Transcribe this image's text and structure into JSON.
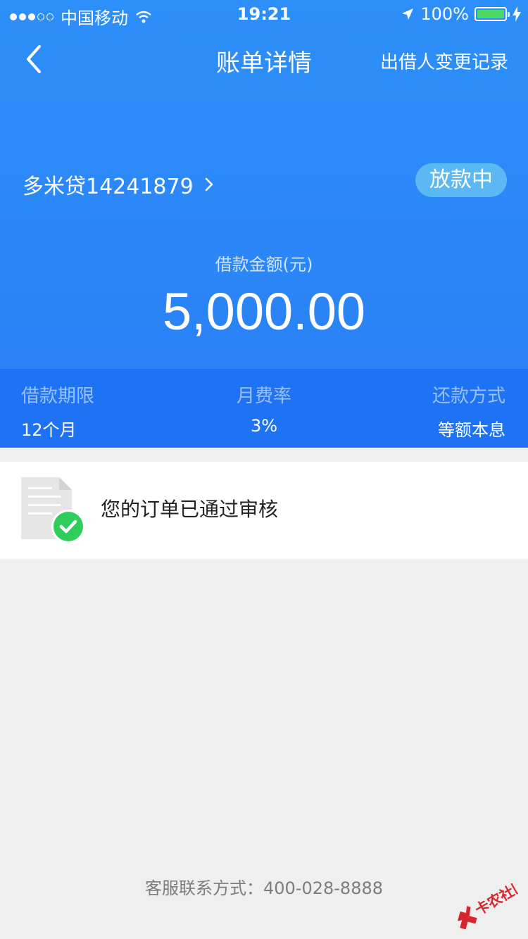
{
  "status_bar": {
    "carrier": "中国移动",
    "time": "19:21",
    "battery": "100%"
  },
  "nav": {
    "title": "账单详情",
    "right_action": "出借人变更记录"
  },
  "product": {
    "name": "多米贷14241879",
    "status": "放款中"
  },
  "loan": {
    "amount_label": "借款金额(元)",
    "amount": "5,000.00"
  },
  "terms": [
    {
      "label": "借款期限",
      "value": "12个月"
    },
    {
      "label": "月费率",
      "value": "3%"
    },
    {
      "label": "还款方式",
      "value": "等额本息"
    }
  ],
  "order": {
    "message": "您的订单已通过审核"
  },
  "footer": {
    "contact": "客服联系方式：400-028-8888"
  },
  "watermark": {
    "text": "卡农社区"
  },
  "colors": {
    "primary": "#2a82f6",
    "terms_bg": "#1e73f4",
    "status_pill": "#5cb8f2",
    "check_green": "#2fce5b",
    "battery_green": "#4cd964"
  }
}
